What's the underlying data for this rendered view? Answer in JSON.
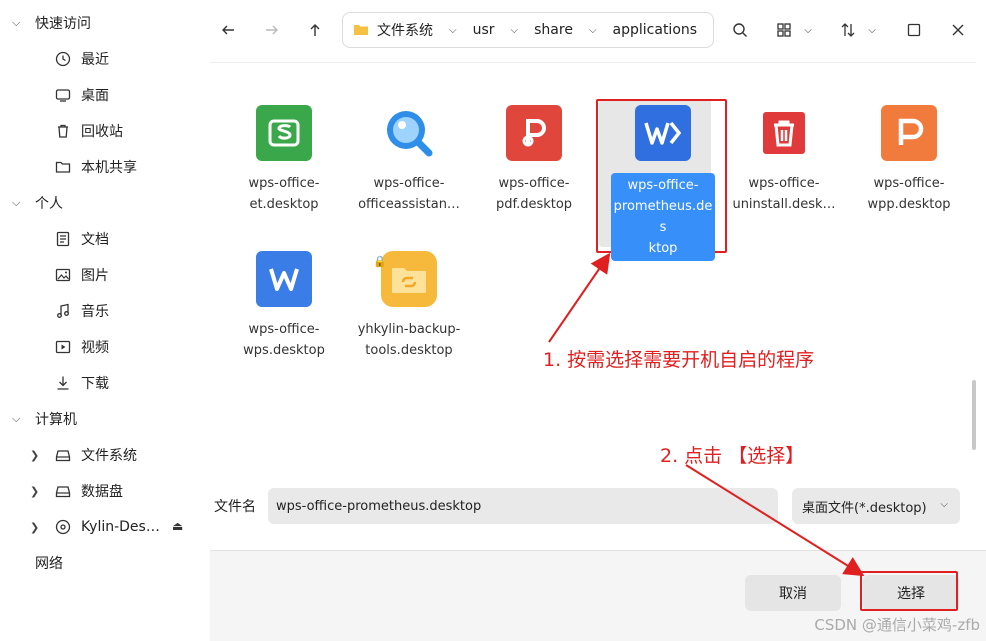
{
  "sidebar": {
    "groups": [
      {
        "label": "快速访问",
        "items": [
          {
            "label": "最近",
            "icon": "clock-icon"
          },
          {
            "label": "桌面",
            "icon": "monitor-icon"
          },
          {
            "label": "回收站",
            "icon": "trash-icon"
          },
          {
            "label": "本机共享",
            "icon": "folder-icon"
          }
        ]
      },
      {
        "label": "个人",
        "items": [
          {
            "label": "文档",
            "icon": "document-icon"
          },
          {
            "label": "图片",
            "icon": "image-icon"
          },
          {
            "label": "音乐",
            "icon": "music-icon"
          },
          {
            "label": "视频",
            "icon": "video-icon"
          },
          {
            "label": "下载",
            "icon": "download-icon"
          }
        ]
      },
      {
        "label": "计算机",
        "items": [
          {
            "label": "文件系统",
            "icon": "drive-icon"
          },
          {
            "label": "数据盘",
            "icon": "drive-icon"
          },
          {
            "label": "Kylin-Des…",
            "icon": "disc-icon"
          }
        ]
      },
      {
        "label": "网络",
        "items": []
      }
    ]
  },
  "breadcrumb": [
    "文件系统",
    "usr",
    "share",
    "applications"
  ],
  "files": [
    {
      "name": "wps-office-et.desktop",
      "line1": "wps-office-",
      "line2": "et.desktop",
      "color": "#3aa84a",
      "icon": "spreadsheet-icon"
    },
    {
      "name": "wps-office-officeassistant",
      "line1": "wps-office-",
      "line2": "officeassistan…",
      "color": "#2f8fe8",
      "icon": "magnifier-icon"
    },
    {
      "name": "wps-office-pdf.desktop",
      "line1": "wps-office-",
      "line2": "pdf.desktop",
      "color": "#e0463b",
      "icon": "pdf-icon"
    },
    {
      "name": "wps-office-prometheus.desktop",
      "line1": "wps-office-",
      "line2": "prometheus.des",
      "line3": "ktop",
      "color": "#2f6fe0",
      "icon": "wps-logo-icon",
      "selected": true
    },
    {
      "name": "wps-office-uninstall.desktop",
      "line1": "wps-office-",
      "line2": "uninstall.desk…",
      "color": "#e03a3a",
      "icon": "uninstall-icon"
    },
    {
      "name": "wps-office-wpp.desktop",
      "line1": "wps-office-",
      "line2": "wpp.desktop",
      "color": "#f07b3c",
      "icon": "presentation-icon"
    },
    {
      "name": "wps-office-wps.desktop",
      "line1": "wps-office-",
      "line2": "wps.desktop",
      "color": "#3b7de6",
      "icon": "writer-icon"
    },
    {
      "name": "yhkylin-backup-tools.desktop",
      "line1": "yhkylin-backup-",
      "line2": "tools.desktop",
      "color": "#f6b93b",
      "icon": "backup-folder-icon"
    }
  ],
  "filename_label": "文件名",
  "filename_value": "wps-office-prometheus.desktop",
  "filter_value": "桌面文件(*.desktop)",
  "cancel_label": "取消",
  "select_label": "选择",
  "annotations": {
    "step1": "1. 按需选择需要开机自启的程序",
    "step2": "2. 点击 【选择】"
  },
  "watermark": "CSDN @通信小菜鸡-zfb",
  "colors": {
    "accent": "#3790fa",
    "annotation": "#e02020"
  }
}
